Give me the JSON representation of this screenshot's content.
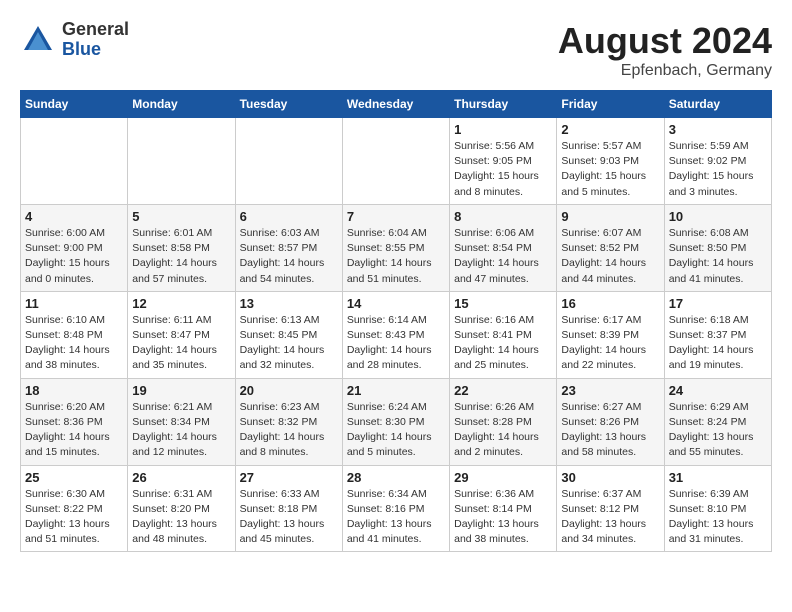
{
  "logo": {
    "general": "General",
    "blue": "Blue"
  },
  "title": {
    "month": "August 2024",
    "location": "Epfenbach, Germany"
  },
  "days_of_week": [
    "Sunday",
    "Monday",
    "Tuesday",
    "Wednesday",
    "Thursday",
    "Friday",
    "Saturday"
  ],
  "weeks": [
    [
      {
        "day": "",
        "detail": ""
      },
      {
        "day": "",
        "detail": ""
      },
      {
        "day": "",
        "detail": ""
      },
      {
        "day": "",
        "detail": ""
      },
      {
        "day": "1",
        "detail": "Sunrise: 5:56 AM\nSunset: 9:05 PM\nDaylight: 15 hours\nand 8 minutes."
      },
      {
        "day": "2",
        "detail": "Sunrise: 5:57 AM\nSunset: 9:03 PM\nDaylight: 15 hours\nand 5 minutes."
      },
      {
        "day": "3",
        "detail": "Sunrise: 5:59 AM\nSunset: 9:02 PM\nDaylight: 15 hours\nand 3 minutes."
      }
    ],
    [
      {
        "day": "4",
        "detail": "Sunrise: 6:00 AM\nSunset: 9:00 PM\nDaylight: 15 hours\nand 0 minutes."
      },
      {
        "day": "5",
        "detail": "Sunrise: 6:01 AM\nSunset: 8:58 PM\nDaylight: 14 hours\nand 57 minutes."
      },
      {
        "day": "6",
        "detail": "Sunrise: 6:03 AM\nSunset: 8:57 PM\nDaylight: 14 hours\nand 54 minutes."
      },
      {
        "day": "7",
        "detail": "Sunrise: 6:04 AM\nSunset: 8:55 PM\nDaylight: 14 hours\nand 51 minutes."
      },
      {
        "day": "8",
        "detail": "Sunrise: 6:06 AM\nSunset: 8:54 PM\nDaylight: 14 hours\nand 47 minutes."
      },
      {
        "day": "9",
        "detail": "Sunrise: 6:07 AM\nSunset: 8:52 PM\nDaylight: 14 hours\nand 44 minutes."
      },
      {
        "day": "10",
        "detail": "Sunrise: 6:08 AM\nSunset: 8:50 PM\nDaylight: 14 hours\nand 41 minutes."
      }
    ],
    [
      {
        "day": "11",
        "detail": "Sunrise: 6:10 AM\nSunset: 8:48 PM\nDaylight: 14 hours\nand 38 minutes."
      },
      {
        "day": "12",
        "detail": "Sunrise: 6:11 AM\nSunset: 8:47 PM\nDaylight: 14 hours\nand 35 minutes."
      },
      {
        "day": "13",
        "detail": "Sunrise: 6:13 AM\nSunset: 8:45 PM\nDaylight: 14 hours\nand 32 minutes."
      },
      {
        "day": "14",
        "detail": "Sunrise: 6:14 AM\nSunset: 8:43 PM\nDaylight: 14 hours\nand 28 minutes."
      },
      {
        "day": "15",
        "detail": "Sunrise: 6:16 AM\nSunset: 8:41 PM\nDaylight: 14 hours\nand 25 minutes."
      },
      {
        "day": "16",
        "detail": "Sunrise: 6:17 AM\nSunset: 8:39 PM\nDaylight: 14 hours\nand 22 minutes."
      },
      {
        "day": "17",
        "detail": "Sunrise: 6:18 AM\nSunset: 8:37 PM\nDaylight: 14 hours\nand 19 minutes."
      }
    ],
    [
      {
        "day": "18",
        "detail": "Sunrise: 6:20 AM\nSunset: 8:36 PM\nDaylight: 14 hours\nand 15 minutes."
      },
      {
        "day": "19",
        "detail": "Sunrise: 6:21 AM\nSunset: 8:34 PM\nDaylight: 14 hours\nand 12 minutes."
      },
      {
        "day": "20",
        "detail": "Sunrise: 6:23 AM\nSunset: 8:32 PM\nDaylight: 14 hours\nand 8 minutes."
      },
      {
        "day": "21",
        "detail": "Sunrise: 6:24 AM\nSunset: 8:30 PM\nDaylight: 14 hours\nand 5 minutes."
      },
      {
        "day": "22",
        "detail": "Sunrise: 6:26 AM\nSunset: 8:28 PM\nDaylight: 14 hours\nand 2 minutes."
      },
      {
        "day": "23",
        "detail": "Sunrise: 6:27 AM\nSunset: 8:26 PM\nDaylight: 13 hours\nand 58 minutes."
      },
      {
        "day": "24",
        "detail": "Sunrise: 6:29 AM\nSunset: 8:24 PM\nDaylight: 13 hours\nand 55 minutes."
      }
    ],
    [
      {
        "day": "25",
        "detail": "Sunrise: 6:30 AM\nSunset: 8:22 PM\nDaylight: 13 hours\nand 51 minutes."
      },
      {
        "day": "26",
        "detail": "Sunrise: 6:31 AM\nSunset: 8:20 PM\nDaylight: 13 hours\nand 48 minutes."
      },
      {
        "day": "27",
        "detail": "Sunrise: 6:33 AM\nSunset: 8:18 PM\nDaylight: 13 hours\nand 45 minutes."
      },
      {
        "day": "28",
        "detail": "Sunrise: 6:34 AM\nSunset: 8:16 PM\nDaylight: 13 hours\nand 41 minutes."
      },
      {
        "day": "29",
        "detail": "Sunrise: 6:36 AM\nSunset: 8:14 PM\nDaylight: 13 hours\nand 38 minutes."
      },
      {
        "day": "30",
        "detail": "Sunrise: 6:37 AM\nSunset: 8:12 PM\nDaylight: 13 hours\nand 34 minutes."
      },
      {
        "day": "31",
        "detail": "Sunrise: 6:39 AM\nSunset: 8:10 PM\nDaylight: 13 hours\nand 31 minutes."
      }
    ]
  ]
}
